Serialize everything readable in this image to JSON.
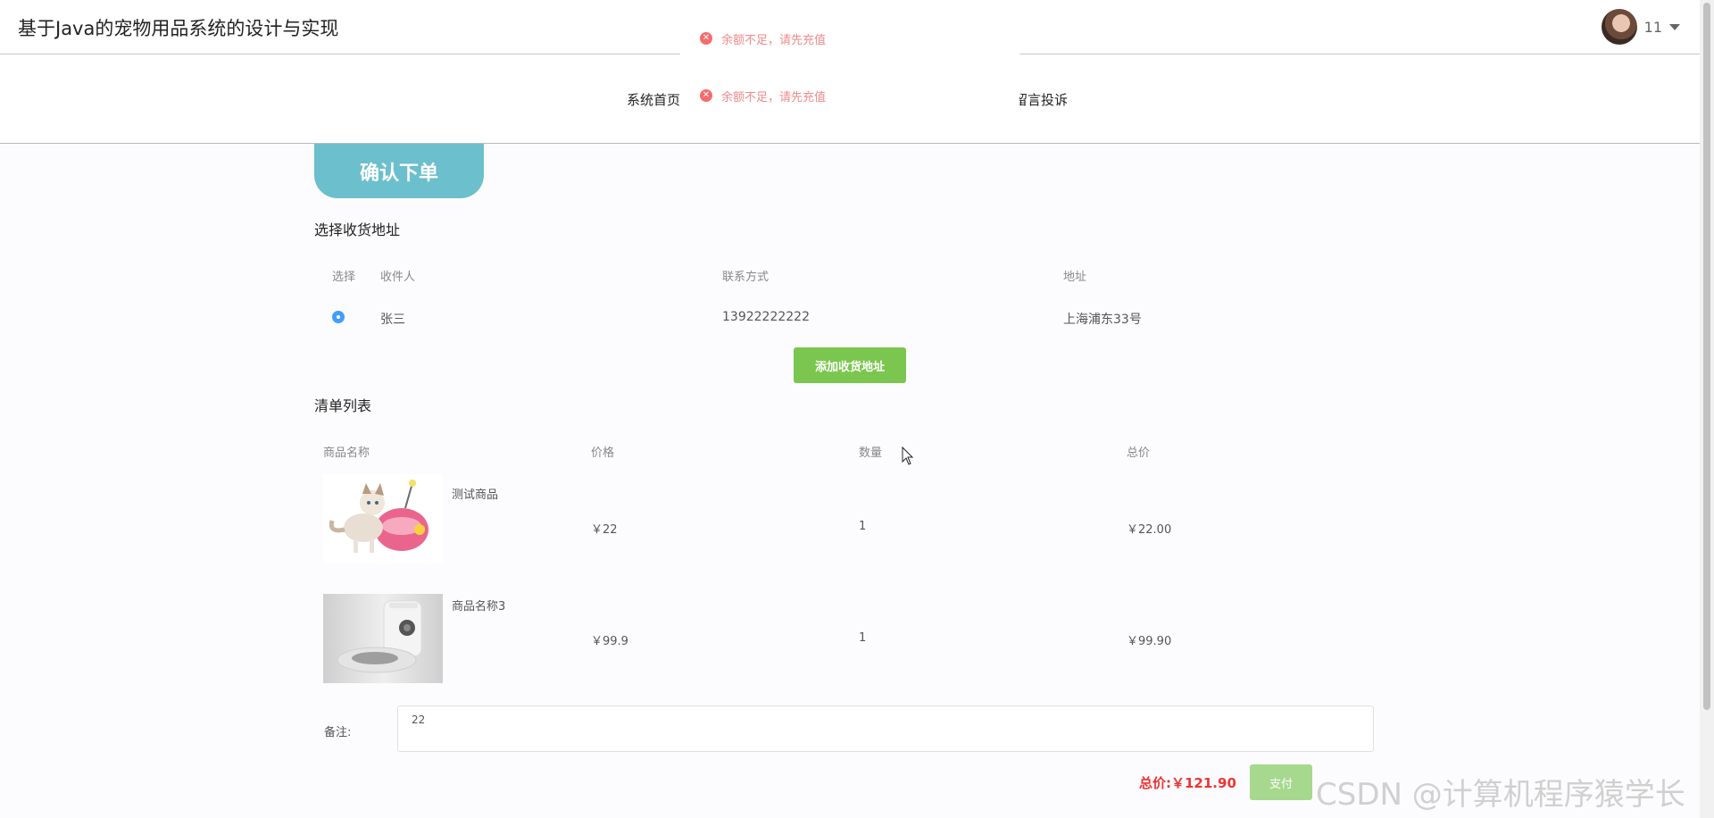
{
  "header": {
    "title": "基于Java的宠物用品系统的设计与实现",
    "username": "11"
  },
  "nav": {
    "home": "系统首页",
    "message": "留言投诉"
  },
  "toasts": [
    "余额不足，请先充值",
    "余额不足，请先充值"
  ],
  "confirm_title": "确认下单",
  "address": {
    "section_title": "选择收货地址",
    "headers": {
      "select": "选择",
      "receiver": "收件人",
      "contact": "联系方式",
      "address": "地址"
    },
    "rows": [
      {
        "receiver": "张三",
        "contact": "13922222222",
        "address": "上海浦东33号",
        "selected": true
      }
    ],
    "add_button": "添加收货地址"
  },
  "order": {
    "section_title": "清单列表",
    "headers": {
      "name": "商品名称",
      "price": "价格",
      "quantity": "数量",
      "total": "总价"
    },
    "items": [
      {
        "name": "测试商品",
        "price": "￥22",
        "quantity": "1",
        "total": "￥22.00"
      },
      {
        "name": "商品名称3",
        "price": "￥99.9",
        "quantity": "1",
        "total": "￥99.90"
      }
    ]
  },
  "note": {
    "label": "备注:",
    "value": "22"
  },
  "summary": {
    "total_label": "总价:￥121.90",
    "pay_button": "支付"
  },
  "watermark": "CSDN @计算机程序猿学长",
  "colors": {
    "accent_tab": "#6cbfcc",
    "add_button": "#7ac64f",
    "pay_button": "#a6d98e",
    "total": "#e33333",
    "error": "#f56c6c"
  }
}
